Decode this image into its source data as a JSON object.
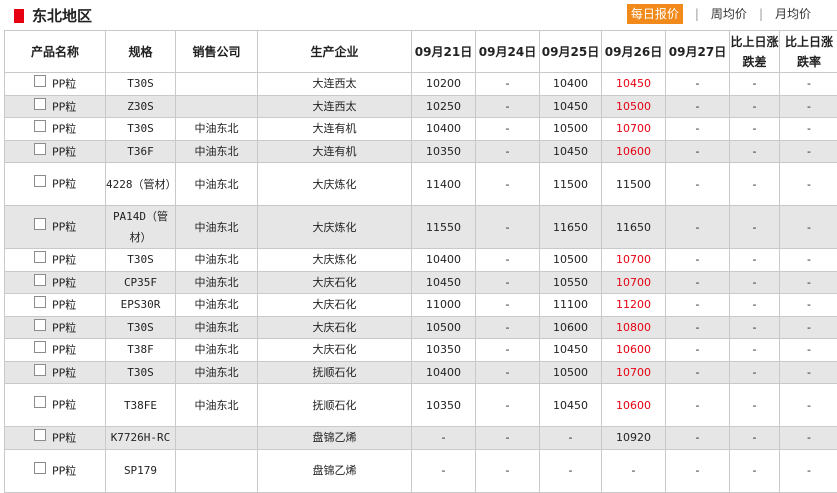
{
  "region": {
    "title": "东北地区"
  },
  "tabs": [
    {
      "label": "每日报价",
      "active": true
    },
    {
      "label": "周均价",
      "active": false
    },
    {
      "label": "月均价",
      "active": false
    }
  ],
  "columns": [
    "产品名称",
    "规格",
    "销售公司",
    "生产企业",
    "09月21日",
    "09月24日",
    "09月25日",
    "09月26日",
    "09月27日",
    "比上日涨跌差",
    "比上日涨跌率"
  ],
  "rows": [
    {
      "product": "PP粒",
      "spec": "T30S",
      "company": "",
      "maker": "大连西太",
      "d21": "10200",
      "d24": "-",
      "d25": "10400",
      "d26": "10450",
      "d27": "-",
      "diff": "-",
      "rate": "-",
      "red": true,
      "shade": false,
      "tall": false
    },
    {
      "product": "PP粒",
      "spec": "Z30S",
      "company": "",
      "maker": "大连西太",
      "d21": "10250",
      "d24": "-",
      "d25": "10450",
      "d26": "10500",
      "d27": "-",
      "diff": "-",
      "rate": "-",
      "red": true,
      "shade": true,
      "tall": false
    },
    {
      "product": "PP粒",
      "spec": "T30S",
      "company": "中油东北",
      "maker": "大连有机",
      "d21": "10400",
      "d24": "-",
      "d25": "10500",
      "d26": "10700",
      "d27": "-",
      "diff": "-",
      "rate": "-",
      "red": true,
      "shade": false,
      "tall": false
    },
    {
      "product": "PP粒",
      "spec": "T36F",
      "company": "中油东北",
      "maker": "大连有机",
      "d21": "10350",
      "d24": "-",
      "d25": "10450",
      "d26": "10600",
      "d27": "-",
      "diff": "-",
      "rate": "-",
      "red": true,
      "shade": true,
      "tall": false
    },
    {
      "product": "PP粒",
      "spec": "4228（管材）",
      "company": "中油东北",
      "maker": "大庆炼化",
      "d21": "11400",
      "d24": "-",
      "d25": "11500",
      "d26": "11500",
      "d27": "-",
      "diff": "-",
      "rate": "-",
      "red": false,
      "shade": false,
      "tall": true
    },
    {
      "product": "PP粒",
      "spec": "PA14D（管材）",
      "company": "中油东北",
      "maker": "大庆炼化",
      "d21": "11550",
      "d24": "-",
      "d25": "11650",
      "d26": "11650",
      "d27": "-",
      "diff": "-",
      "rate": "-",
      "red": false,
      "shade": true,
      "tall": true
    },
    {
      "product": "PP粒",
      "spec": "T30S",
      "company": "中油东北",
      "maker": "大庆炼化",
      "d21": "10400",
      "d24": "-",
      "d25": "10500",
      "d26": "10700",
      "d27": "-",
      "diff": "-",
      "rate": "-",
      "red": true,
      "shade": false,
      "tall": false
    },
    {
      "product": "PP粒",
      "spec": "CP35F",
      "company": "中油东北",
      "maker": "大庆石化",
      "d21": "10450",
      "d24": "-",
      "d25": "10550",
      "d26": "10700",
      "d27": "-",
      "diff": "-",
      "rate": "-",
      "red": true,
      "shade": true,
      "tall": false
    },
    {
      "product": "PP粒",
      "spec": "EPS30R",
      "company": "中油东北",
      "maker": "大庆石化",
      "d21": "11000",
      "d24": "-",
      "d25": "11100",
      "d26": "11200",
      "d27": "-",
      "diff": "-",
      "rate": "-",
      "red": true,
      "shade": false,
      "tall": false
    },
    {
      "product": "PP粒",
      "spec": "T30S",
      "company": "中油东北",
      "maker": "大庆石化",
      "d21": "10500",
      "d24": "-",
      "d25": "10600",
      "d26": "10800",
      "d27": "-",
      "diff": "-",
      "rate": "-",
      "red": true,
      "shade": true,
      "tall": false
    },
    {
      "product": "PP粒",
      "spec": "T38F",
      "company": "中油东北",
      "maker": "大庆石化",
      "d21": "10350",
      "d24": "-",
      "d25": "10450",
      "d26": "10600",
      "d27": "-",
      "diff": "-",
      "rate": "-",
      "red": true,
      "shade": false,
      "tall": false
    },
    {
      "product": "PP粒",
      "spec": "T30S",
      "company": "中油东北",
      "maker": "抚顺石化",
      "d21": "10400",
      "d24": "-",
      "d25": "10500",
      "d26": "10700",
      "d27": "-",
      "diff": "-",
      "rate": "-",
      "red": true,
      "shade": true,
      "tall": false
    },
    {
      "product": "PP粒",
      "spec": "T38FE",
      "company": "中油东北",
      "maker": "抚顺石化",
      "d21": "10350",
      "d24": "-",
      "d25": "10450",
      "d26": "10600",
      "d27": "-",
      "diff": "-",
      "rate": "-",
      "red": true,
      "shade": false,
      "tall": true
    },
    {
      "product": "PP粒",
      "spec": "K7726H-RC",
      "company": "",
      "maker": "盘锦乙烯",
      "d21": "-",
      "d24": "-",
      "d25": "-",
      "d26": "10920",
      "d27": "-",
      "diff": "-",
      "rate": "-",
      "red": false,
      "shade": true,
      "tall": false
    },
    {
      "product": "PP粒",
      "spec": "SP179",
      "company": "",
      "maker": "盘锦乙烯",
      "d21": "-",
      "d24": "-",
      "d25": "-",
      "d26": "-",
      "d27": "-",
      "diff": "-",
      "rate": "-",
      "red": false,
      "shade": false,
      "tall": true
    }
  ],
  "colors": {
    "accent": "#f2891b",
    "marker": "#e60012",
    "up": "#e60012",
    "shade": "#e6e6e6",
    "border": "#c9c9c9"
  }
}
